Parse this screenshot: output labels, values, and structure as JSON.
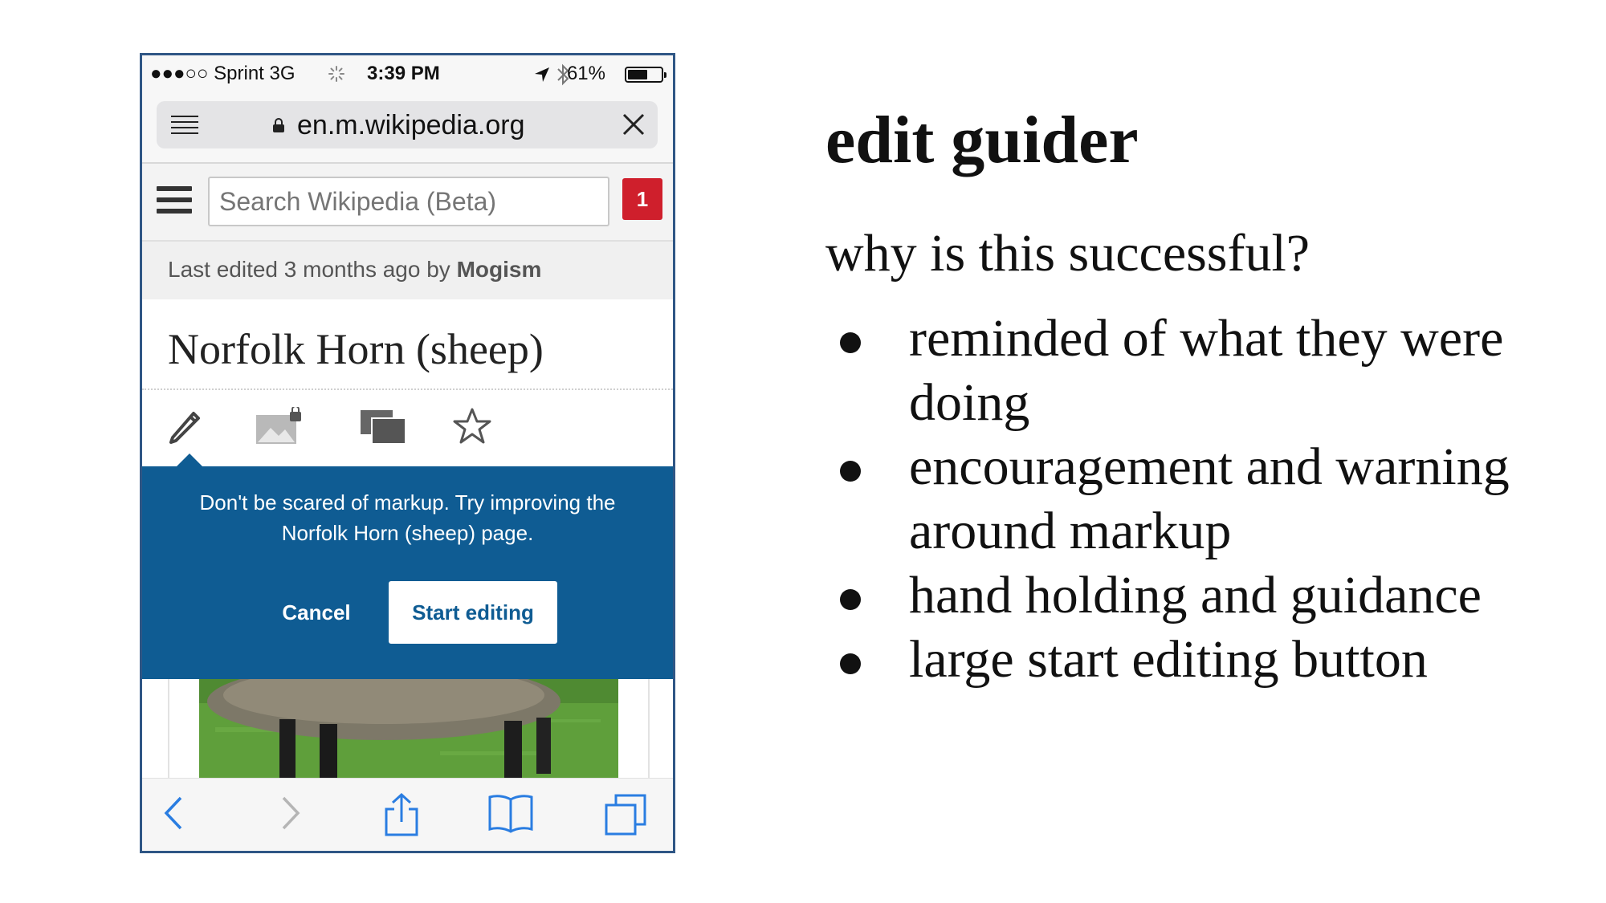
{
  "status_bar": {
    "carrier": "●●●○○ Sprint  3G",
    "time": "3:39 PM",
    "battery": "61%",
    "battery_level": 0.61
  },
  "browser": {
    "url": "en.m.wikipedia.org"
  },
  "wiki": {
    "search_placeholder": "Search Wikipedia (Beta)",
    "notification_count": "1",
    "last_edited_prefix": "Last edited 3 months ago by ",
    "last_edited_user": "Mogism",
    "page_title": "Norfolk Horn (sheep)"
  },
  "guider": {
    "message": "Don't be scared of markup. Try improving the Norfolk Horn (sheep) page.",
    "cancel_label": "Cancel",
    "start_label": "Start editing"
  },
  "slide": {
    "title": "edit guider",
    "question": "why is this successful?",
    "bullets": [
      "reminded of what they were doing",
      "encouragement and warning around markup",
      "hand holding and guidance",
      "large start editing button"
    ]
  },
  "colors": {
    "guider_blue": "#0f5c93",
    "notification_red": "#cf1f2c",
    "phone_border": "#2f5685",
    "ios_blue": "#2a7de1"
  }
}
